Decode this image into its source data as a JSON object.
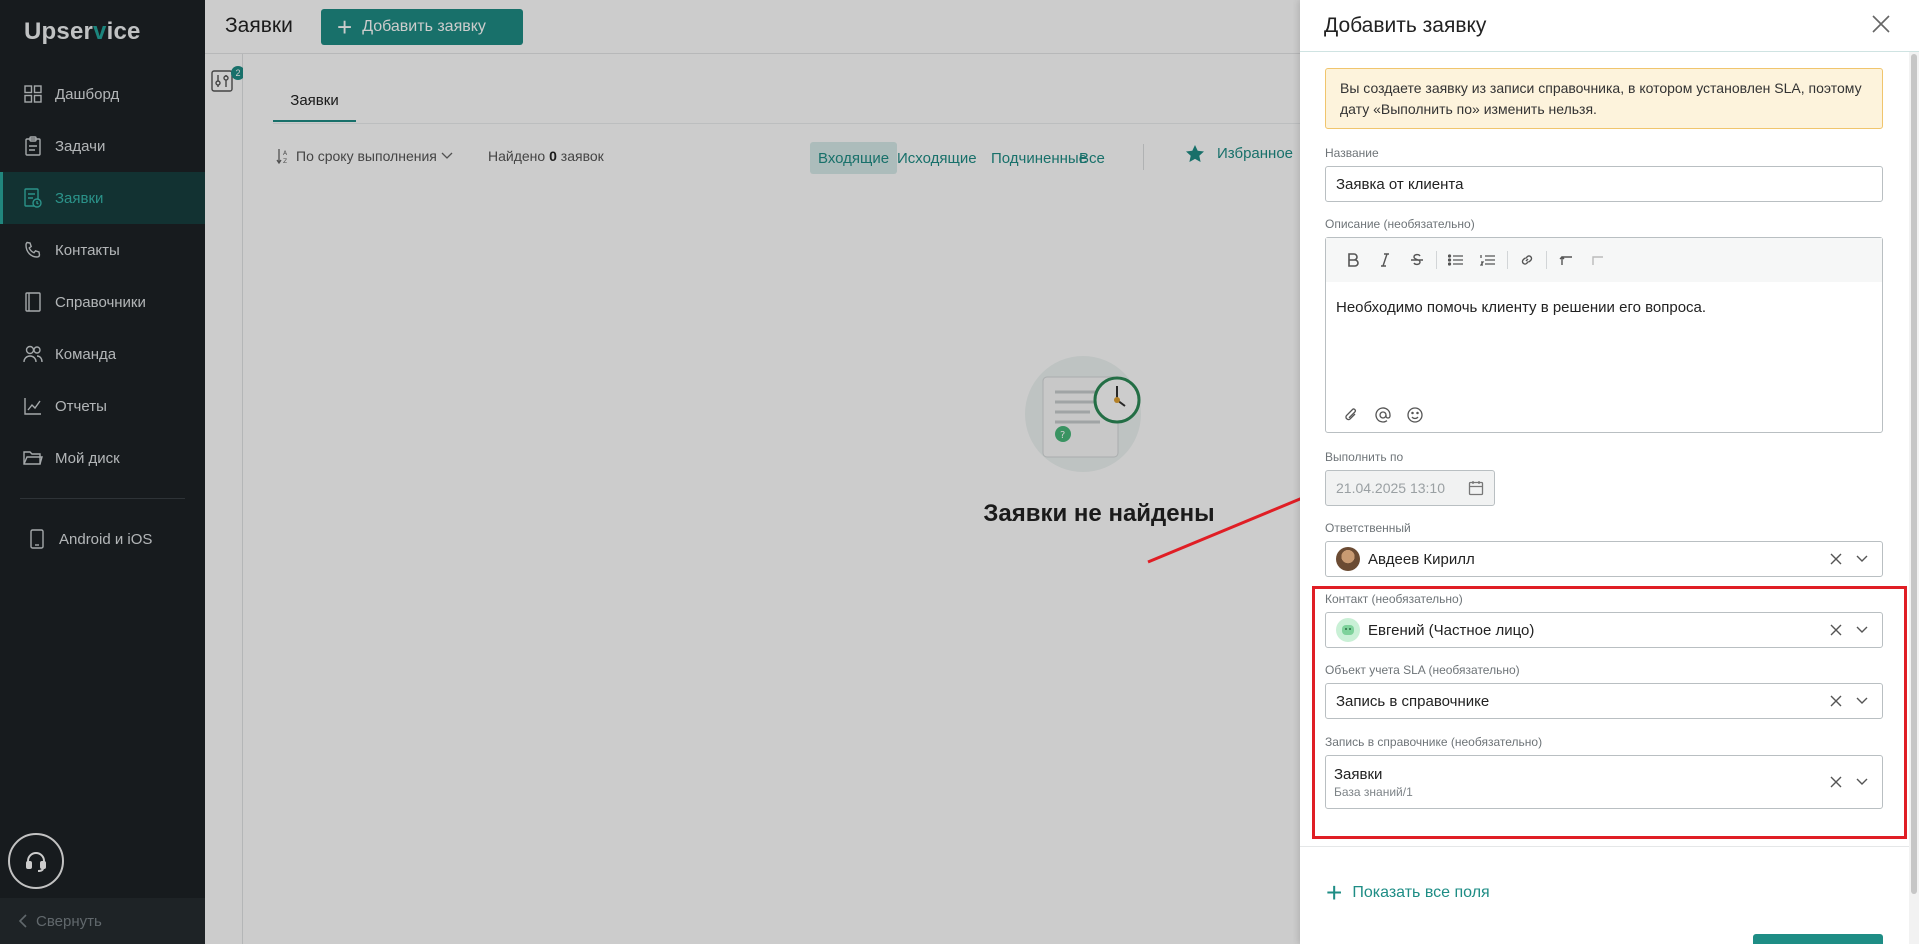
{
  "sidebar": {
    "logo_pre": "Upser",
    "logo_mark": "v",
    "logo_post": "ice",
    "items": [
      {
        "label": "Дашборд",
        "icon": "grid-icon"
      },
      {
        "label": "Задачи",
        "icon": "clipboard-icon"
      },
      {
        "label": "Заявки",
        "icon": "tickets-icon",
        "active": true
      },
      {
        "label": "Контакты",
        "icon": "phone-icon"
      },
      {
        "label": "Справочники",
        "icon": "book-icon"
      },
      {
        "label": "Команда",
        "icon": "team-icon"
      },
      {
        "label": "Отчеты",
        "icon": "chart-icon"
      },
      {
        "label": "Мой диск",
        "icon": "folder-icon"
      }
    ],
    "mobile_label": "Android и iOS",
    "collapse_label": "Свернуть"
  },
  "header": {
    "title": "Заявки",
    "add_button": "Добавить заявку"
  },
  "filter_badge": "2",
  "tabs": [
    {
      "label": "Заявки"
    }
  ],
  "toolbar": {
    "sort_label": "По сроку выполнения",
    "found_prefix": "Найдено ",
    "found_count": "0",
    "found_suffix": " заявок",
    "segments": [
      "Входящие",
      "Исходящие",
      "Подчиненные",
      "Все"
    ],
    "favorites": "Избранное"
  },
  "empty": {
    "title": "Заявки не найдены"
  },
  "panel": {
    "title": "Добавить заявку",
    "note": "Вы создаете заявку из записи справочника, в котором установлен SLA, поэтому дату «Выполнить по» изменить нельзя.",
    "name_label": "Название",
    "name_value": "Заявка от клиента",
    "desc_label": "Описание (необязательно)",
    "desc_value": "Необходимо помочь клиенту в решении его вопроса.",
    "due_label": "Выполнить по",
    "due_value": "21.04.2025 13:10",
    "assignee_label": "Ответственный",
    "assignee_value": "Авдеев Кирилл",
    "contact_label": "Контакт (необязательно)",
    "contact_value": "Евгений (Частное лицо)",
    "sla_label": "Объект учета SLA (необязательно)",
    "sla_value": "Запись в справочнике",
    "record_label": "Запись в справочнике (необязательно)",
    "record_value": "Заявки",
    "record_sub": "База знаний/1",
    "show_all": "Показать все поля"
  },
  "colors": {
    "accent": "#1e8d85",
    "highlight": "#e01e25",
    "sidebar_bg": "#1d2226",
    "warning_bg": "#fdf3dc"
  }
}
